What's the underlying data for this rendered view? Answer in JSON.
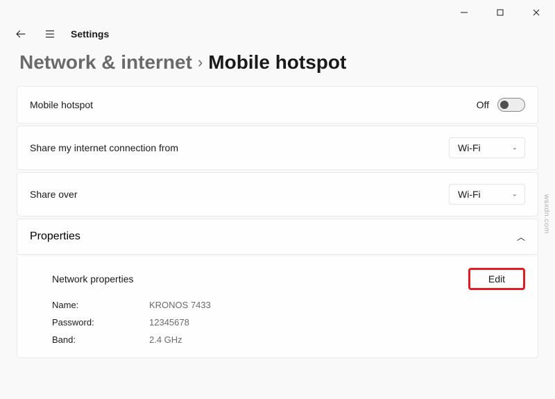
{
  "window": {
    "app_name": "Settings"
  },
  "breadcrumb": {
    "parent": "Network & internet",
    "current": "Mobile hotspot"
  },
  "hotspot_card": {
    "label": "Mobile hotspot",
    "state_text": "Off"
  },
  "share_from_card": {
    "label": "Share my internet connection from",
    "value": "Wi-Fi"
  },
  "share_over_card": {
    "label": "Share over",
    "value": "Wi-Fi"
  },
  "properties": {
    "header_label": "Properties",
    "network_properties_label": "Network properties",
    "edit_button": "Edit",
    "fields": {
      "name_label": "Name:",
      "name_value": "KRONOS 7433",
      "password_label": "Password:",
      "password_value": "12345678",
      "band_label": "Band:",
      "band_value": "2.4 GHz"
    }
  },
  "watermark": "wsxdn.com"
}
